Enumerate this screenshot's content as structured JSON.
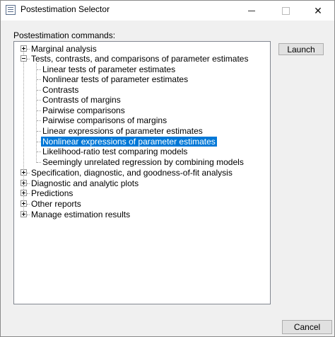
{
  "window": {
    "title": "Postestimation Selector"
  },
  "group_label": "Postestimation commands:",
  "buttons": {
    "launch": "Launch",
    "cancel": "Cancel"
  },
  "tree": {
    "nodes": [
      {
        "label": "Marginal analysis",
        "expanded": false
      },
      {
        "label": "Tests, contrasts, and comparisons of parameter estimates",
        "expanded": true,
        "children": [
          "Linear tests of parameter estimates",
          "Nonlinear tests of parameter estimates",
          "Contrasts",
          "Contrasts of margins",
          "Pairwise comparisons",
          "Pairwise comparisons of margins",
          "Linear expressions of parameter estimates",
          "Nonlinear expressions of parameter estimates",
          "Likelihood-ratio test comparing models",
          "Seemingly unrelated regression by combining models"
        ],
        "selected_child": "Nonlinear expressions of parameter estimates"
      },
      {
        "label": "Specification, diagnostic, and goodness-of-fit analysis",
        "expanded": false
      },
      {
        "label": "Diagnostic and analytic plots",
        "expanded": false
      },
      {
        "label": "Predictions",
        "expanded": false
      },
      {
        "label": "Other reports",
        "expanded": false
      },
      {
        "label": "Manage estimation results",
        "expanded": false
      }
    ]
  }
}
